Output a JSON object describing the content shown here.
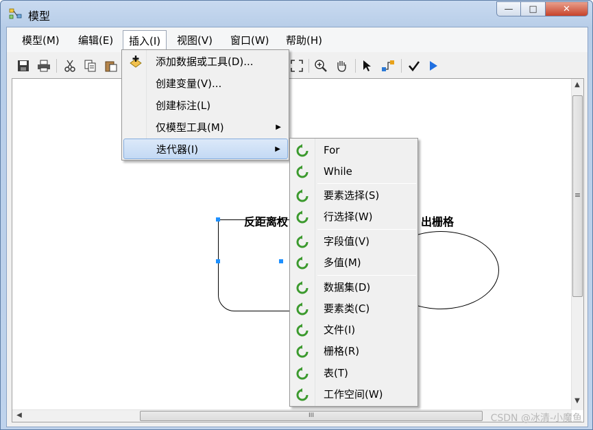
{
  "window": {
    "title": "模型",
    "app_icon": "model-builder-icon",
    "controls": {
      "minimize": "—",
      "maximize": "□",
      "close": "✕"
    }
  },
  "menubar": {
    "items": [
      {
        "label": "模型(M)"
      },
      {
        "label": "编辑(E)"
      },
      {
        "label": "插入(I)",
        "active": true
      },
      {
        "label": "视图(V)"
      },
      {
        "label": "窗口(W)"
      },
      {
        "label": "帮助(H)"
      }
    ]
  },
  "toolbar": {
    "icons": [
      "save-icon",
      "print-icon",
      "cut-icon",
      "copy-icon",
      "paste-icon",
      "full-extent-icon",
      "zoom-in-icon",
      "pan-icon",
      "select-icon",
      "connect-icon",
      "validate-icon",
      "run-icon"
    ]
  },
  "insert_menu": {
    "items": [
      {
        "label": "添加数据或工具(D)...",
        "icon": "add-data-icon"
      },
      {
        "label": "创建变量(V)..."
      },
      {
        "label": "创建标注(L)"
      },
      {
        "label": "仅模型工具(M)",
        "submenu": true
      },
      {
        "label": "迭代器(I)",
        "submenu": true,
        "highlighted": true
      }
    ]
  },
  "iterator_submenu": {
    "items": [
      {
        "label": "For",
        "icon": "iterator-icon"
      },
      {
        "label": "While",
        "icon": "iterator-icon"
      },
      {
        "label": "要素选择(S)",
        "icon": "iterator-icon"
      },
      {
        "label": "行选择(W)",
        "icon": "iterator-icon"
      },
      {
        "label": "字段值(V)",
        "icon": "iterator-icon"
      },
      {
        "label": "多值(M)",
        "icon": "iterator-icon"
      },
      {
        "label": "数据集(D)",
        "icon": "iterator-icon"
      },
      {
        "label": "要素类(C)",
        "icon": "iterator-icon"
      },
      {
        "label": "文件(I)",
        "icon": "iterator-icon"
      },
      {
        "label": "栅格(R)",
        "icon": "iterator-icon"
      },
      {
        "label": "表(T)",
        "icon": "iterator-icon"
      },
      {
        "label": "工作空间(W)",
        "icon": "iterator-icon"
      }
    ]
  },
  "canvas": {
    "node_left_label": "反距离权",
    "node_right_label": "出栅格"
  },
  "scrollbar": {
    "h_grip": "III",
    "v_grip": "≡"
  },
  "watermark": "CSDN @冰清-小魔鱼"
}
